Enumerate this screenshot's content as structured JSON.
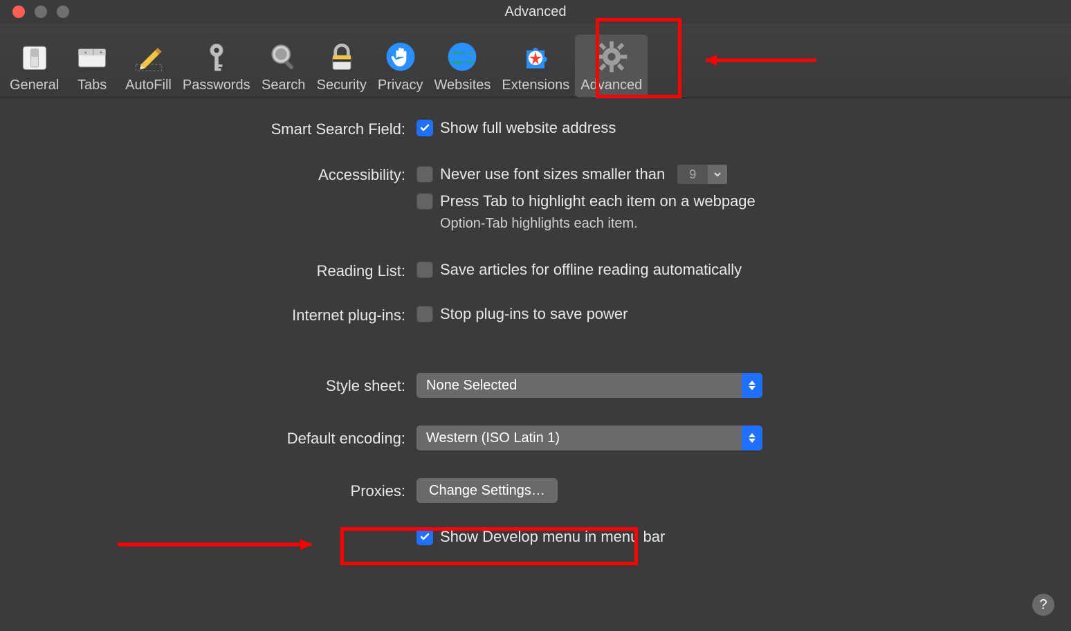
{
  "window": {
    "title": "Advanced"
  },
  "toolbar": {
    "items": [
      {
        "id": "general",
        "label": "General"
      },
      {
        "id": "tabs",
        "label": "Tabs"
      },
      {
        "id": "autofill",
        "label": "AutoFill"
      },
      {
        "id": "passwords",
        "label": "Passwords"
      },
      {
        "id": "search",
        "label": "Search"
      },
      {
        "id": "security",
        "label": "Security"
      },
      {
        "id": "privacy",
        "label": "Privacy"
      },
      {
        "id": "websites",
        "label": "Websites"
      },
      {
        "id": "extensions",
        "label": "Extensions"
      },
      {
        "id": "advanced",
        "label": "Advanced"
      }
    ],
    "selected_id": "advanced"
  },
  "sections": {
    "smart_search": {
      "label": "Smart Search Field:",
      "show_full_address": {
        "text": "Show full website address",
        "checked": true
      }
    },
    "accessibility": {
      "label": "Accessibility:",
      "min_font": {
        "text": "Never use font sizes smaller than",
        "checked": false,
        "value": "9"
      },
      "press_tab": {
        "text": "Press Tab to highlight each item on a webpage",
        "checked": false
      },
      "hint": "Option-Tab highlights each item."
    },
    "reading_list": {
      "label": "Reading List:",
      "save_offline": {
        "text": "Save articles for offline reading automatically",
        "checked": false
      }
    },
    "plugins": {
      "label": "Internet plug-ins:",
      "stop_plugins": {
        "text": "Stop plug-ins to save power",
        "checked": false
      }
    },
    "style_sheet": {
      "label": "Style sheet:",
      "value": "None Selected"
    },
    "default_encoding": {
      "label": "Default encoding:",
      "value": "Western (ISO Latin 1)"
    },
    "proxies": {
      "label": "Proxies:",
      "button": "Change Settings…"
    },
    "develop_menu": {
      "text": "Show Develop menu in menu bar",
      "checked": true
    }
  },
  "help_button": "?"
}
